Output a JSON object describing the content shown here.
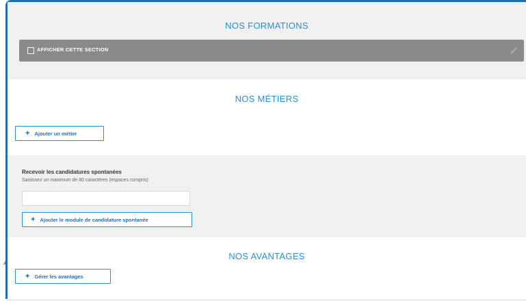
{
  "formations": {
    "title": "NOS FORMATIONS",
    "show_section_label": "AFFICHER CETTE SECTION",
    "edit_icon": "pencil-icon"
  },
  "metiers": {
    "title": "NOS MÉTIERS",
    "add_button_label": "Ajouter un métier"
  },
  "candidatures": {
    "title": "Recevoir les candidatures spontanées",
    "hint": "Saisissez un maximum de 80 caractères (espaces compris)",
    "input_value": "",
    "add_button_label": "Ajouter le module de candidature spontanée"
  },
  "avantages": {
    "title": "NOS AVANTAGES",
    "manage_button_label": "Gérer les avantages"
  },
  "colors": {
    "accent": "#2a8fd0",
    "frame": "#1f6fb0",
    "bar": "#8a8a8c",
    "panel": "#f0f0f0"
  },
  "icons": {
    "plus": "+"
  }
}
